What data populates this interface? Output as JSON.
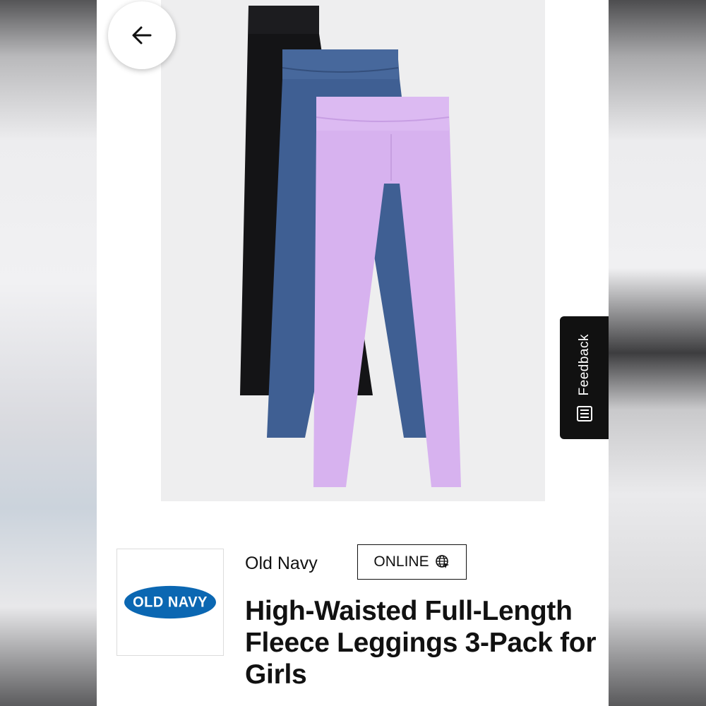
{
  "colors": {
    "page_background": "#ffffff",
    "image_background": "#eeeeef",
    "legging_black": "#141416",
    "legging_blue": "#3f5f93",
    "legging_lavender": "#d7b2ef",
    "logo_blue": "#0b67b2",
    "feedback_tab": "#111111"
  },
  "icons": {
    "back": "arrow-left-icon",
    "feedback": "list-icon",
    "online": "globe-cursor-icon"
  },
  "product": {
    "image_alt": "High-Waisted Full-Length Fleece Leggings 3-Pack",
    "brand_logo_text": "OLD NAVY",
    "brand_name": "Old Navy",
    "availability_badge": "ONLINE",
    "title": "High-Waisted Full-Length Fleece Leggings 3-Pack for Girls"
  },
  "feedback": {
    "label": "Feedback"
  }
}
